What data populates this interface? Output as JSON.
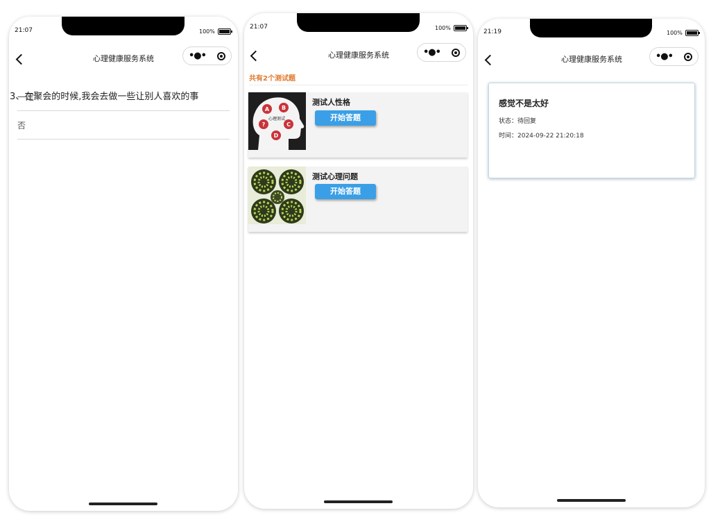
{
  "phone1": {
    "time": "21:07",
    "battery": "100%",
    "nav_title": "心理健康服务系统",
    "question": "3、在聚会的时候,我会去做一些让别人喜欢的事",
    "options": [
      "一定",
      "否"
    ]
  },
  "phone2": {
    "time": "21:07",
    "battery": "100%",
    "nav_title": "心理健康服务系统",
    "count_label": "共有2个测试题",
    "cards": [
      {
        "title": "测试人性格",
        "button": "开始答题",
        "thumb_letters": [
          "A",
          "B",
          "?",
          "C",
          "D"
        ],
        "thumb_text": "心理测试"
      },
      {
        "title": "测试心理问题",
        "button": "开始答题"
      }
    ]
  },
  "phone3": {
    "time": "21:19",
    "battery": "100%",
    "nav_title": "心理健康服务系统",
    "message": {
      "title": "感觉不是太好",
      "status": "状态：待回复",
      "time": "时间：2024-09-22 21:20:18"
    }
  },
  "colors": {
    "accent_button": "#3a9fe6",
    "count_text": "#e07a2f"
  }
}
